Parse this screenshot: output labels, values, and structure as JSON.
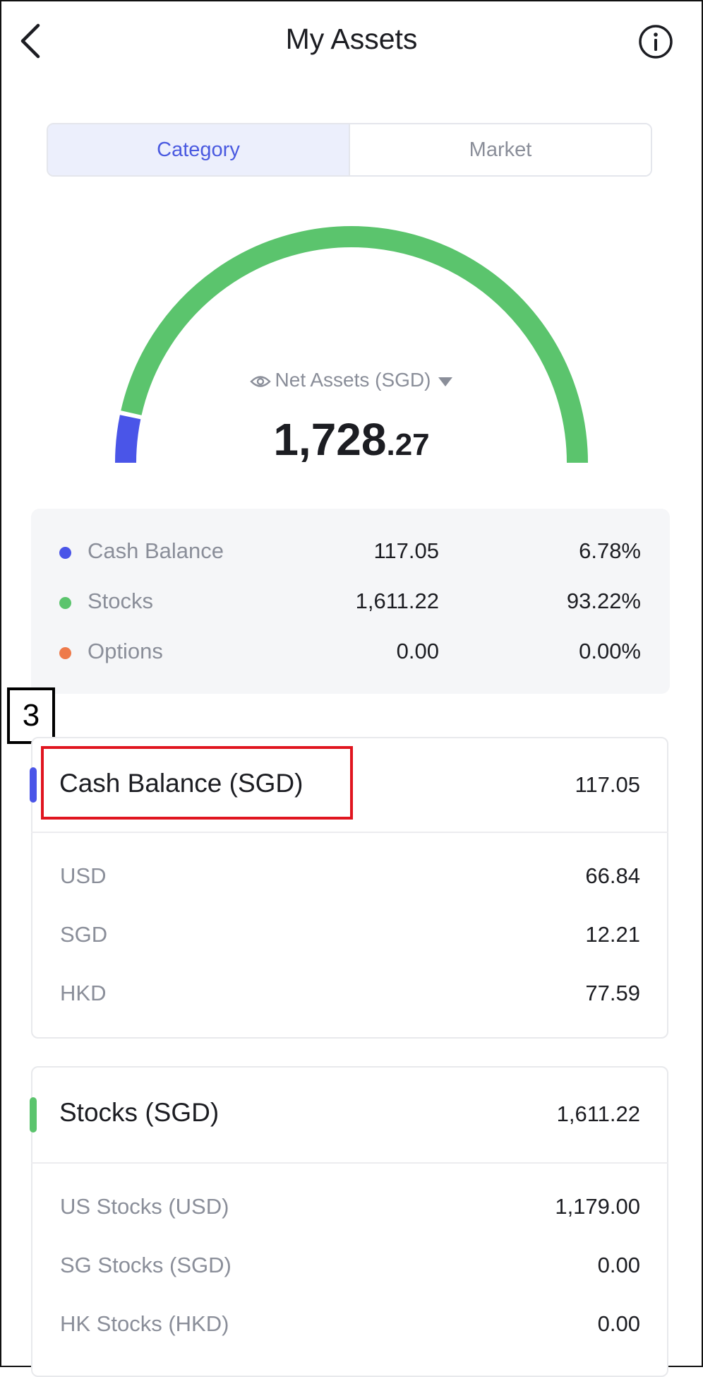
{
  "header": {
    "title": "My Assets",
    "back_icon": "chevron-left-icon",
    "info_icon": "info-circle-icon"
  },
  "tabs": [
    {
      "label": "Category",
      "active": true
    },
    {
      "label": "Market",
      "active": false
    }
  ],
  "net_assets": {
    "label": "Net Assets (SGD)",
    "value_int": "1,728",
    "value_dec": ".27",
    "eye_icon": "eye-icon",
    "dropdown_icon": "caret-down-icon"
  },
  "gauge": {
    "segments": [
      {
        "name": "Cash Balance",
        "fraction": 0.0678,
        "color": "#4a55e8"
      },
      {
        "name": "Stocks",
        "fraction": 0.9322,
        "color": "#5bc46d"
      }
    ]
  },
  "summary": [
    {
      "name": "Cash Balance",
      "value": "117.05",
      "percent": "6.78%",
      "color": "#4a55e8"
    },
    {
      "name": "Stocks",
      "value": "1,611.22",
      "percent": "93.22%",
      "color": "#5bc46d"
    },
    {
      "name": "Options",
      "value": "0.00",
      "percent": "0.00%",
      "color": "#ee7a4a"
    }
  ],
  "step_marker": "3",
  "cash_card": {
    "title": "Cash Balance (SGD)",
    "total": "117.05",
    "accent": "#4a55e8",
    "rows": [
      {
        "label": "USD",
        "value": "66.84"
      },
      {
        "label": "SGD",
        "value": "12.21"
      },
      {
        "label": "HKD",
        "value": "77.59"
      }
    ]
  },
  "stocks_card": {
    "title": "Stocks (SGD)",
    "total": "1,611.22",
    "accent": "#5bc46d",
    "rows": [
      {
        "label": "US Stocks (USD)",
        "value": "1,179.00"
      },
      {
        "label": "SG Stocks (SGD)",
        "value": "0.00"
      },
      {
        "label": "HK Stocks (HKD)",
        "value": "0.00"
      }
    ]
  },
  "colors": {
    "accent_blue": "#4a5ae0",
    "highlight_red": "#e0151f"
  }
}
